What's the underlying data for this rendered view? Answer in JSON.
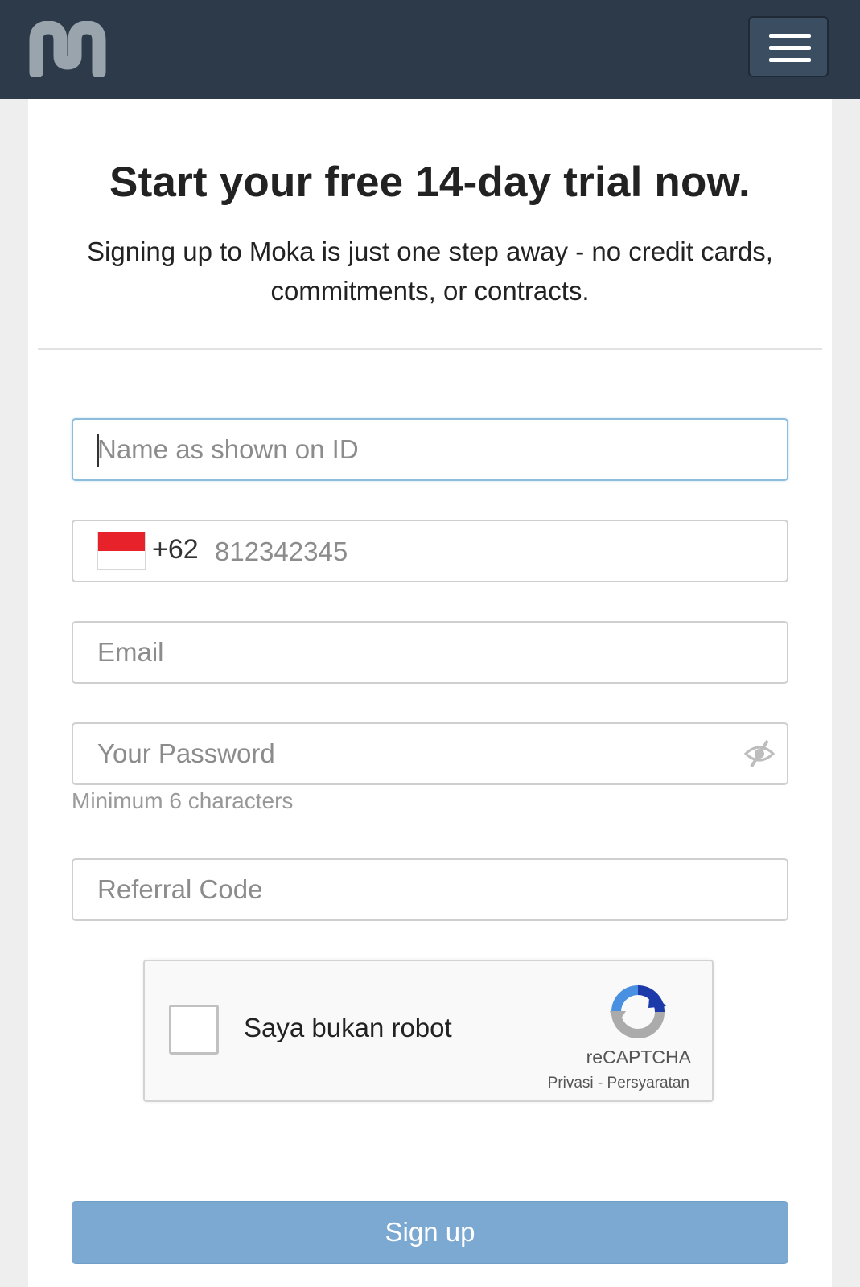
{
  "header": {
    "logo_icon": "moka-logo-icon",
    "menu_icon": "hamburger-menu-icon",
    "colors": {
      "background": "#2c3a4a",
      "logo": "#9aa4ad"
    }
  },
  "hero": {
    "title": "Start your free 14-day trial now.",
    "subtitle": "Signing up to Moka is just one step away - no credit cards, commitments, or contracts."
  },
  "form": {
    "name_placeholder": "Name as shown on ID",
    "phone": {
      "country_code": "+62",
      "placeholder": "812342345",
      "flag_icon": "indonesia-flag-icon"
    },
    "email_placeholder": "Email",
    "password_placeholder": "Your Password",
    "password_toggle_icon": "eye-slash-icon",
    "password_hint": "Minimum 6 characters",
    "referral_placeholder": "Referral Code",
    "captcha": {
      "label": "Saya bukan robot",
      "brand": "reCAPTCHA",
      "privacy": "Privasi",
      "separator": " - ",
      "terms": "Persyaratan",
      "logo_icon": "recaptcha-logo-icon"
    },
    "submit_label": "Sign up",
    "colors": {
      "focus_border": "#8cbddb",
      "submit_bg": "#7ca9d2"
    }
  }
}
